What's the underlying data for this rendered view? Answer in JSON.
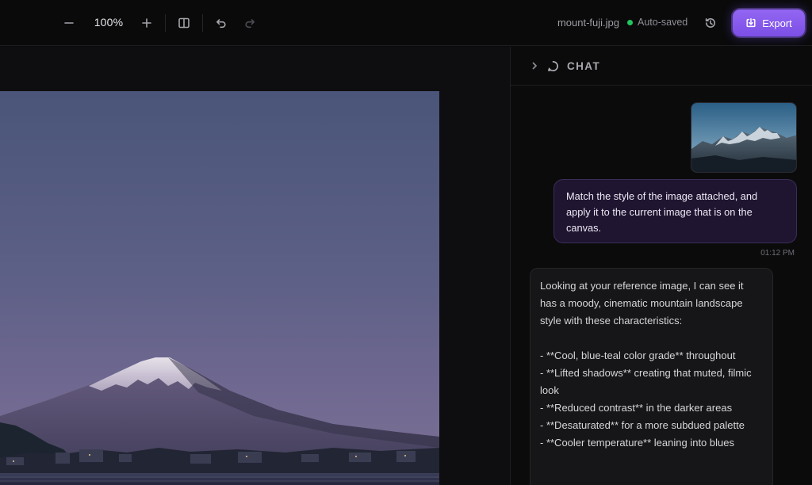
{
  "toolbar": {
    "zoom_out_icon": "minus-icon",
    "zoom_level": "100%",
    "zoom_in_icon": "plus-icon",
    "compare_icon": "split-view-icon",
    "undo_icon": "undo-icon",
    "redo_icon": "redo-icon",
    "filename": "mount-fuji.jpg",
    "save_status": "Auto-saved",
    "save_status_color": "#22c55e",
    "history_icon": "history-icon",
    "export_label": "Export",
    "export_color": "#8b5cf6"
  },
  "chat": {
    "title": "CHAT",
    "user_message": "Match the style of the image attached, and apply it to the current image that is on the canvas.",
    "user_time": "01:12 PM",
    "assistant_intro": "Looking at your reference image, I can see it has a moody, cinematic mountain landscape style with these characteristics:",
    "assistant_points": [
      "- **Cool, blue-teal color grade** throughout",
      "- **Lifted shadows** creating that muted, filmic look",
      "- **Reduced contrast** in the darker areas",
      "- **Desaturated** for a more subdued palette",
      "- **Cooler temperature** leaning into blues"
    ]
  }
}
